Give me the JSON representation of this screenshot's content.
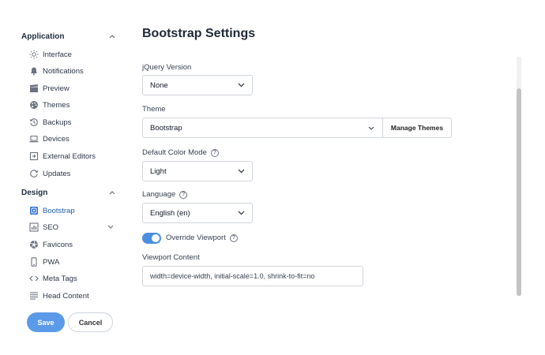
{
  "sidebar": {
    "sections": [
      {
        "label": "Application",
        "items": [
          {
            "label": "Interface",
            "icon": "sun-icon"
          },
          {
            "label": "Notifications",
            "icon": "bell-icon"
          },
          {
            "label": "Preview",
            "icon": "clapperboard-icon"
          },
          {
            "label": "Themes",
            "icon": "palette-icon"
          },
          {
            "label": "Backups",
            "icon": "history-icon"
          },
          {
            "label": "Devices",
            "icon": "laptop-icon"
          },
          {
            "label": "External Editors",
            "icon": "external-editor-icon"
          },
          {
            "label": "Updates",
            "icon": "refresh-icon"
          }
        ]
      },
      {
        "label": "Design",
        "items": [
          {
            "label": "Bootstrap",
            "icon": "bootstrap-icon",
            "active": true
          },
          {
            "label": "SEO",
            "icon": "chart-icon"
          },
          {
            "label": "Favicons",
            "icon": "aperture-icon"
          },
          {
            "label": "PWA",
            "icon": "phone-icon"
          },
          {
            "label": "Meta Tags",
            "icon": "code-icon"
          },
          {
            "label": "Head Content",
            "icon": "lines-icon"
          }
        ]
      }
    ],
    "save_label": "Save",
    "cancel_label": "Cancel"
  },
  "main": {
    "title": "Bootstrap Settings",
    "jquery": {
      "label": "jQuery Version",
      "value": "None"
    },
    "theme": {
      "label": "Theme",
      "value": "Bootstrap",
      "manage_label": "Manage Themes"
    },
    "color_mode": {
      "label": "Default Color Mode",
      "value": "Light"
    },
    "language": {
      "label": "Language",
      "value": "English (en)"
    },
    "override_viewport": {
      "label": "Override Viewport",
      "enabled": true
    },
    "viewport_content": {
      "label": "Viewport Content",
      "value": "width=device-width, initial-scale=1.0, shrink-to-fit=no"
    }
  },
  "colors": {
    "accent": "#4a8fe0",
    "save_button": "#5b9ae8",
    "active_text": "#1e5fa8"
  }
}
